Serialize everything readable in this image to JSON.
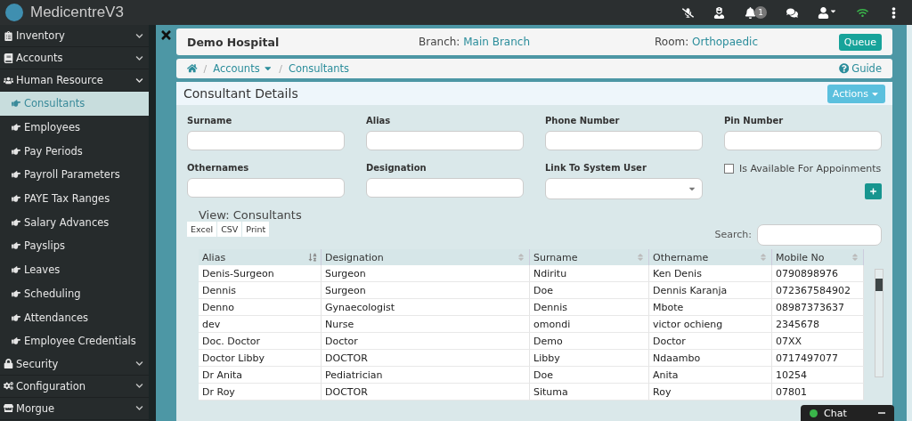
{
  "app": {
    "title": "MedicentreV3"
  },
  "topbar": {
    "notification_count": "1"
  },
  "sidebar": {
    "items": [
      {
        "label": "Inventory",
        "expanded": false
      },
      {
        "label": "Accounts",
        "expanded": false
      },
      {
        "label": "Human Resource",
        "expanded": true,
        "children": [
          {
            "label": "Consultants",
            "selected": true
          },
          {
            "label": "Employees",
            "selected": false
          },
          {
            "label": "Pay Periods",
            "selected": false
          },
          {
            "label": "Payroll Parameters",
            "selected": false
          },
          {
            "label": "PAYE Tax Ranges",
            "selected": false
          },
          {
            "label": "Salary Advances",
            "selected": false
          },
          {
            "label": "Payslips",
            "selected": false
          },
          {
            "label": "Leaves",
            "selected": false
          },
          {
            "label": "Scheduling",
            "selected": false
          },
          {
            "label": "Attendances",
            "selected": false
          },
          {
            "label": "Employee Credentials",
            "selected": false
          }
        ]
      },
      {
        "label": "Security",
        "expanded": false
      },
      {
        "label": "Configuration",
        "expanded": false
      },
      {
        "label": "Morgue",
        "expanded": false
      }
    ]
  },
  "header": {
    "hospital": "Demo Hospital",
    "branch_label": "Branch:",
    "branch": "Main Branch",
    "room_label": "Room:",
    "room": "Orthopaedic",
    "queue_button": "Queue"
  },
  "breadcrumb": {
    "separator": "/",
    "items": [
      "Accounts",
      "Consultants"
    ],
    "guide": "Guide"
  },
  "form": {
    "title": "Consultant Details",
    "actions_button": "Actions",
    "fields": [
      {
        "kind": "text",
        "label": "Surname"
      },
      {
        "kind": "text",
        "label": "Alias"
      },
      {
        "kind": "text",
        "label": "Phone Number"
      },
      {
        "kind": "text",
        "label": "Pin Number"
      },
      {
        "kind": "text",
        "label": "Othernames"
      },
      {
        "kind": "text",
        "label": "Designation"
      },
      {
        "kind": "select",
        "label": "Link To System User"
      },
      {
        "kind": "checkbox",
        "label": "Is Available For Appoinments",
        "checked": false
      }
    ]
  },
  "table": {
    "title": "View: Consultants",
    "export_buttons": [
      "Excel",
      "CSV",
      "Print"
    ],
    "search_label": "Search:",
    "columns": [
      {
        "label": "Alias",
        "sorted": true
      },
      {
        "label": "Designation",
        "sorted": false
      },
      {
        "label": "Surname",
        "sorted": false
      },
      {
        "label": "Othername",
        "sorted": false
      },
      {
        "label": "Mobile No",
        "sorted": false
      }
    ],
    "rows": [
      [
        "Denis-Surgeon",
        "Surgeon",
        "Ndiritu",
        "Ken Denis",
        "0790898976"
      ],
      [
        "Dennis",
        "Surgeon",
        "Doe",
        "Dennis Karanja",
        "072367584902"
      ],
      [
        "Denno",
        "Gynaecologist",
        "Dennis",
        "Mbote",
        "08987373637"
      ],
      [
        "dev",
        "Nurse",
        "omondi",
        "victor ochieng",
        "2345678"
      ],
      [
        "Doc. Doctor",
        "Doctor",
        "Demo",
        "Doctor",
        "07XX"
      ],
      [
        "Doctor Libby",
        "DOCTOR",
        "Libby",
        "Ndaambo",
        "0717497077"
      ],
      [
        "Dr Anita",
        "Pediatrician",
        "Doe",
        "Anita",
        "10254"
      ],
      [
        "Dr Roy",
        "DOCTOR",
        "Situma",
        "Roy",
        "07801"
      ]
    ]
  },
  "chat": {
    "label": "Chat",
    "online": true
  }
}
